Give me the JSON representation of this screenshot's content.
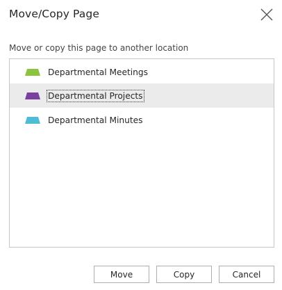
{
  "dialog": {
    "title": "Move/Copy Page",
    "instruction": "Move or copy this page to another location"
  },
  "notebooks": [
    {
      "label": "Departmental Meetings",
      "color": "#8cc43f",
      "selected": false
    },
    {
      "label": "Departmental Projects",
      "color": "#7b3fa0",
      "selected": true
    },
    {
      "label": "Departmental Minutes",
      "color": "#4fbcd6",
      "selected": false
    }
  ],
  "buttons": {
    "move": "Move",
    "copy": "Copy",
    "cancel": "Cancel"
  },
  "colors": {
    "selection_background": "#ebebeb",
    "border": "#c6c6c6"
  }
}
